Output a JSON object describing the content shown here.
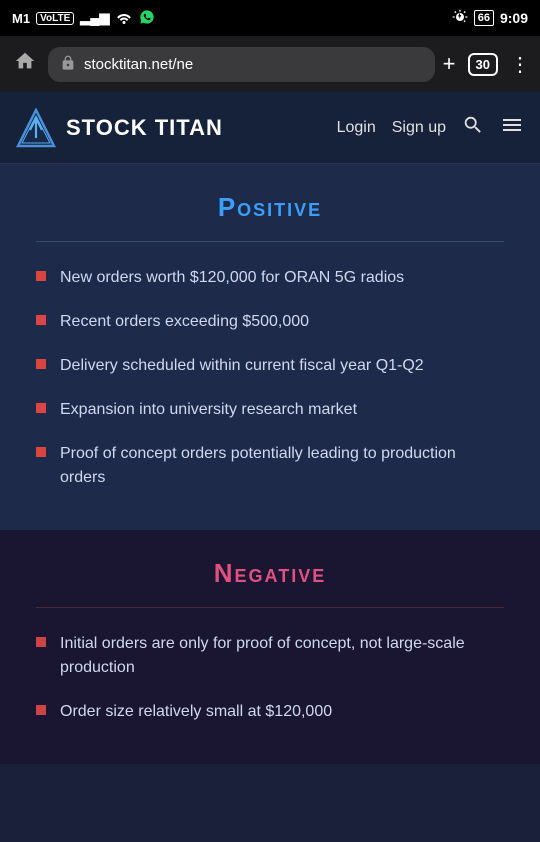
{
  "status_bar": {
    "carrier": "M1",
    "carrier_type": "VoLTE",
    "signal_bars": "▂▄▆",
    "wifi": "WiFi",
    "whatsapp_icon": "WhatsApp",
    "time": "9:09",
    "battery": "66",
    "alarm_icon": "alarm"
  },
  "browser": {
    "url": "stocktitan.net/ne",
    "tab_count": "30",
    "home_label": "⌂",
    "plus_label": "+",
    "more_label": "⋮"
  },
  "site_header": {
    "logo_alt": "Stock Titan Logo",
    "site_name": "STOCK TITAN",
    "nav": {
      "login": "Login",
      "signup": "Sign up",
      "search": "Search",
      "menu": "Menu"
    }
  },
  "positive_section": {
    "title": "Positive",
    "divider": true,
    "bullets": [
      "New orders worth $120,000 for ORAN 5G radios",
      "Recent orders exceeding $500,000",
      "Delivery scheduled within current fiscal year Q1-Q2",
      "Expansion into university research market",
      "Proof of concept orders potentially leading to production orders"
    ]
  },
  "negative_section": {
    "title": "Negative",
    "divider": true,
    "bullets": [
      "Initial orders are only for proof of concept, not large-scale production",
      "Order size relatively small at $120,000"
    ]
  }
}
